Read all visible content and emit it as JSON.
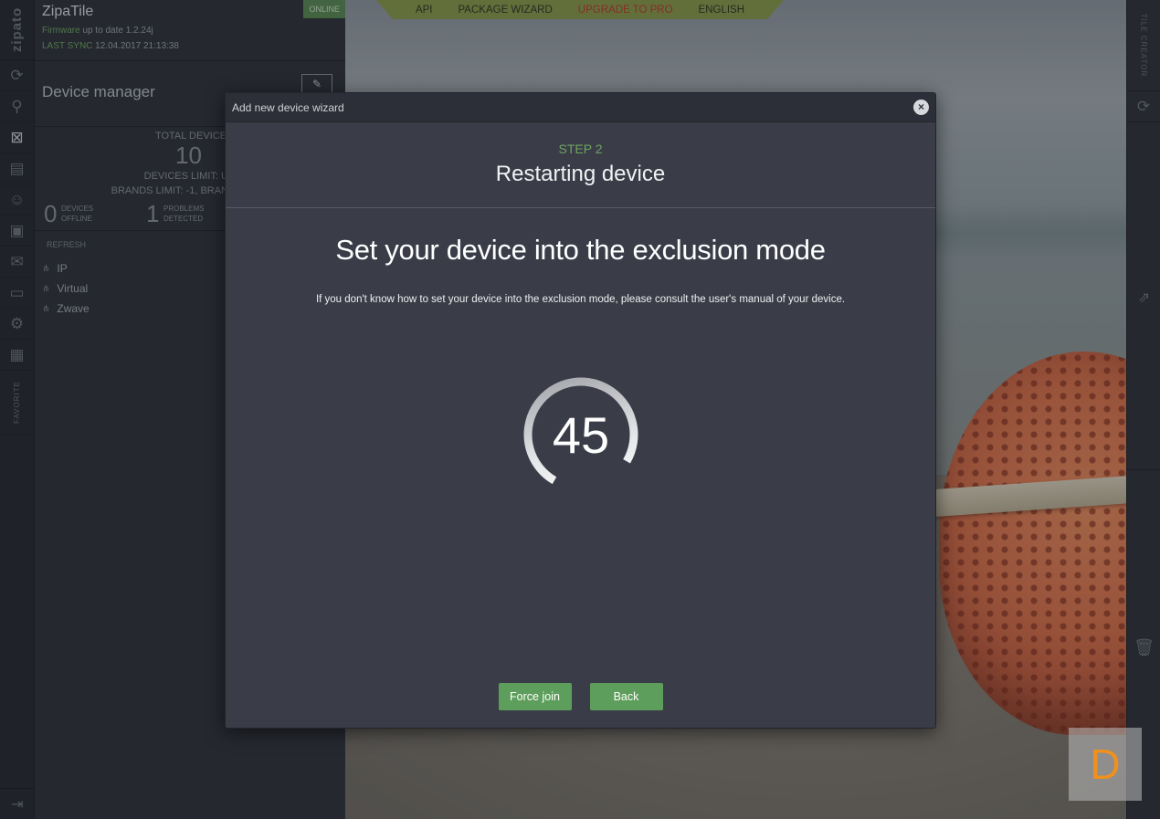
{
  "app": {
    "brand": "zipato",
    "name": "ZipaTile",
    "status": "ONLINE",
    "firmware_label": "Firmware",
    "firmware_text": "up to date 1.2.24j",
    "sync_label": "LAST SYNC",
    "sync_time": "12.04.2017 21:13:38"
  },
  "topmenu": {
    "items": [
      "API",
      "PACKAGE WIZARD",
      "UPGRADE TO PRO",
      "ENGLISH"
    ]
  },
  "iconbar": {
    "favorite_label": "FAVORITE",
    "icons": [
      "sync-icon",
      "search-icon",
      "devices-icon",
      "scenes-icon",
      "users-icon",
      "rules-icon",
      "messages-icon",
      "rooms-icon",
      "settings-icon",
      "calendar-icon"
    ]
  },
  "device_manager": {
    "title": "Device manager",
    "total_label": "TOTAL DEVICE",
    "total_value": "10",
    "devices_limit": "DEVICES LIMIT: UNL",
    "brands_limit": "BRANDS LIMIT: -1, BRAN",
    "offline_value": "0",
    "offline_label_1": "DEVICES",
    "offline_label_2": "OFFLINE",
    "problems_value": "1",
    "problems_label_1": "PROBLEMS",
    "problems_label_2": "DETECTED",
    "refresh": "REFRESH",
    "tree": [
      "IP",
      "Virtual",
      "Zwave"
    ]
  },
  "rightbar": {
    "title": "TILE CREATOR"
  },
  "modal": {
    "title": "Add new device wizard",
    "step": "STEP 2",
    "step_name": "Restarting device",
    "heading": "Set your device into the exclusion mode",
    "hint": "If you don't know how to set your device into the exclusion mode, please consult the user's manual of your device.",
    "countdown": "45",
    "countdown_progress": 0.75,
    "force_join_label": "Force join",
    "back_label": "Back"
  },
  "badge": {
    "letter": "D",
    "color": "#f0901e"
  },
  "colors": {
    "accent_green": "#5e9e5c",
    "step_green": "#6ea45f",
    "pro_red": "#b83a2a"
  }
}
